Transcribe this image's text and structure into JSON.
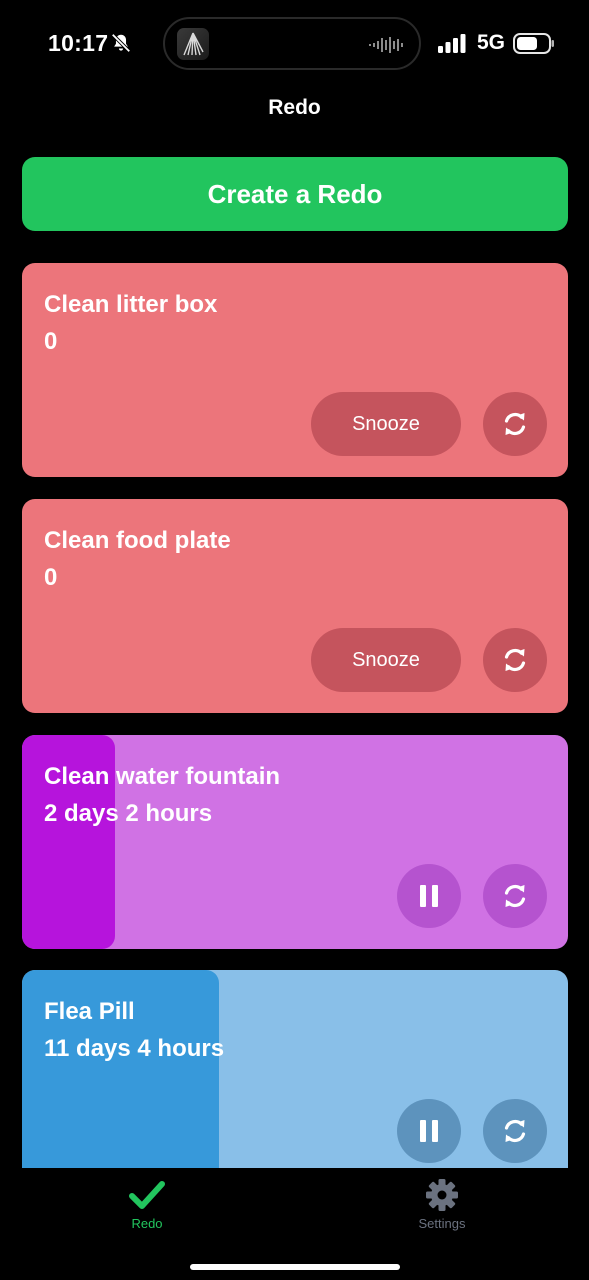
{
  "status_bar": {
    "time": "10:17",
    "network": "5G",
    "icons": [
      "bell-slash-icon",
      "signal-bars-icon",
      "battery-icon"
    ]
  },
  "header": {
    "title": "Redo"
  },
  "create_button": {
    "label": "Create a Redo",
    "color": "#22c55e"
  },
  "cards": [
    {
      "title": "Clean litter box",
      "time": "0",
      "state": "overdue",
      "progress": 0,
      "snooze_label": "Snooze",
      "colors": {
        "background": "#ec757b",
        "button": "#c5545d",
        "progress": "#ec757b"
      }
    },
    {
      "title": "Clean food plate",
      "time": "0",
      "state": "overdue",
      "progress": 0,
      "snooze_label": "Snooze",
      "colors": {
        "background": "#ec757b",
        "button": "#c5545d",
        "progress": "#ec757b"
      }
    },
    {
      "title": "Clean water fountain",
      "time": "2 days 2 hours",
      "state": "running",
      "progress": 0.17,
      "colors": {
        "background": "#d072e4",
        "button": "#b553cf",
        "progress": "#b614dc"
      }
    },
    {
      "title": "Flea Pill",
      "time": "11 days 4 hours",
      "state": "running",
      "progress": 0.36,
      "colors": {
        "background": "#89bfe8",
        "button": "#5d93bd",
        "progress": "#3799da"
      }
    }
  ],
  "tab_bar": {
    "tabs": [
      {
        "label": "Redo",
        "icon": "checkmark-icon",
        "active": true,
        "color": "#22c55e"
      },
      {
        "label": "Settings",
        "icon": "gear-icon",
        "active": false,
        "color": "#6b7280"
      }
    ]
  }
}
